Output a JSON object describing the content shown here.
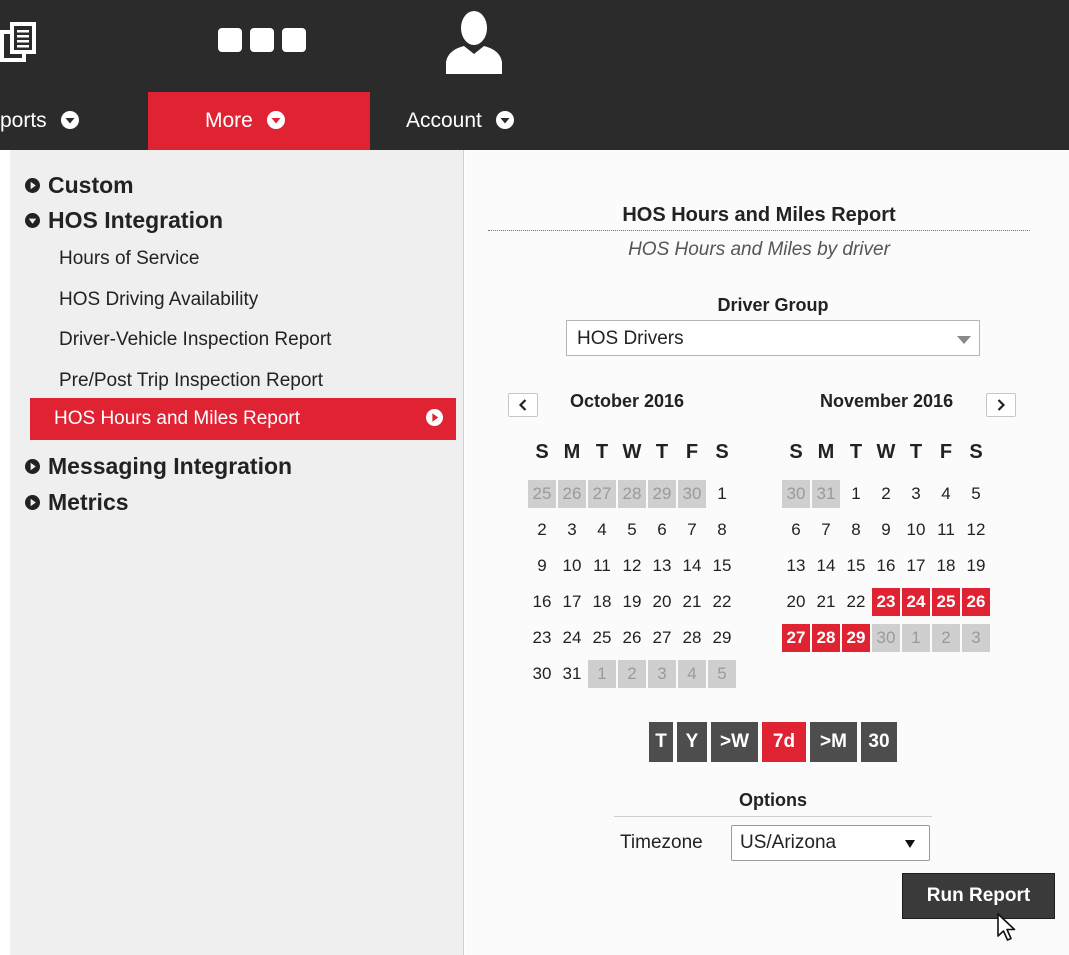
{
  "nav": {
    "reports_label": "ports",
    "more_label": "More",
    "account_label": "Account"
  },
  "menu": {
    "custom": "Custom",
    "hos_integration": "HOS Integration",
    "links": [
      "Hours of Service",
      "HOS Driving Availability",
      "Driver-Vehicle Inspection Report",
      "Pre/Post Trip Inspection Report"
    ],
    "active": "HOS Hours and Miles Report",
    "messaging": "Messaging Integration",
    "metrics": "Metrics"
  },
  "report": {
    "title": "HOS Hours and Miles Report",
    "subtitle": "HOS Hours and Miles by driver",
    "driver_group_label": "Driver Group",
    "driver_group_value": "HOS Drivers"
  },
  "calendar": {
    "dow": [
      "S",
      "M",
      "T",
      "W",
      "T",
      "F",
      "S"
    ],
    "months": [
      {
        "title": "October 2016",
        "weeks": [
          [
            [
              "25",
              "o"
            ],
            [
              "26",
              "o"
            ],
            [
              "27",
              "o"
            ],
            [
              "28",
              "o"
            ],
            [
              "29",
              "o"
            ],
            [
              "30",
              "o"
            ],
            [
              "1",
              "n"
            ]
          ],
          [
            [
              "2",
              "n"
            ],
            [
              "3",
              "n"
            ],
            [
              "4",
              "n"
            ],
            [
              "5",
              "n"
            ],
            [
              "6",
              "n"
            ],
            [
              "7",
              "n"
            ],
            [
              "8",
              "n"
            ]
          ],
          [
            [
              "9",
              "n"
            ],
            [
              "10",
              "n"
            ],
            [
              "11",
              "n"
            ],
            [
              "12",
              "n"
            ],
            [
              "13",
              "n"
            ],
            [
              "14",
              "n"
            ],
            [
              "15",
              "n"
            ]
          ],
          [
            [
              "16",
              "n"
            ],
            [
              "17",
              "n"
            ],
            [
              "18",
              "n"
            ],
            [
              "19",
              "n"
            ],
            [
              "20",
              "n"
            ],
            [
              "21",
              "n"
            ],
            [
              "22",
              "n"
            ]
          ],
          [
            [
              "23",
              "n"
            ],
            [
              "24",
              "n"
            ],
            [
              "25",
              "n"
            ],
            [
              "26",
              "n"
            ],
            [
              "27",
              "n"
            ],
            [
              "28",
              "n"
            ],
            [
              "29",
              "n"
            ]
          ],
          [
            [
              "30",
              "n"
            ],
            [
              "31",
              "n"
            ],
            [
              "1",
              "o"
            ],
            [
              "2",
              "o"
            ],
            [
              "3",
              "o"
            ],
            [
              "4",
              "o"
            ],
            [
              "5",
              "o"
            ]
          ]
        ]
      },
      {
        "title": "November 2016",
        "weeks": [
          [
            [
              "30",
              "o"
            ],
            [
              "31",
              "o"
            ],
            [
              "1",
              "n"
            ],
            [
              "2",
              "n"
            ],
            [
              "3",
              "n"
            ],
            [
              "4",
              "n"
            ],
            [
              "5",
              "n"
            ]
          ],
          [
            [
              "6",
              "n"
            ],
            [
              "7",
              "n"
            ],
            [
              "8",
              "n"
            ],
            [
              "9",
              "n"
            ],
            [
              "10",
              "n"
            ],
            [
              "11",
              "n"
            ],
            [
              "12",
              "n"
            ]
          ],
          [
            [
              "13",
              "n"
            ],
            [
              "14",
              "n"
            ],
            [
              "15",
              "n"
            ],
            [
              "16",
              "n"
            ],
            [
              "17",
              "n"
            ],
            [
              "18",
              "n"
            ],
            [
              "19",
              "n"
            ]
          ],
          [
            [
              "20",
              "n"
            ],
            [
              "21",
              "n"
            ],
            [
              "22",
              "n"
            ],
            [
              "23",
              "s"
            ],
            [
              "24",
              "s"
            ],
            [
              "25",
              "s"
            ],
            [
              "26",
              "s"
            ]
          ],
          [
            [
              "27",
              "s"
            ],
            [
              "28",
              "s"
            ],
            [
              "29",
              "s"
            ],
            [
              "30",
              "o"
            ],
            [
              "1",
              "o"
            ],
            [
              "2",
              "o"
            ],
            [
              "3",
              "o"
            ]
          ]
        ]
      }
    ]
  },
  "quick_ranges": [
    {
      "label": "T",
      "active": false
    },
    {
      "label": "Y",
      "active": false
    },
    {
      "label": ">W",
      "active": false
    },
    {
      "label": "7d",
      "active": true
    },
    {
      "label": ">M",
      "active": false
    },
    {
      "label": "30",
      "active": false
    }
  ],
  "options": {
    "label": "Options",
    "timezone_label": "Timezone",
    "timezone_value": "US/Arizona"
  },
  "run_label": "Run Report",
  "colors": {
    "accent": "#e02333",
    "topbar": "#2b2b2b"
  }
}
